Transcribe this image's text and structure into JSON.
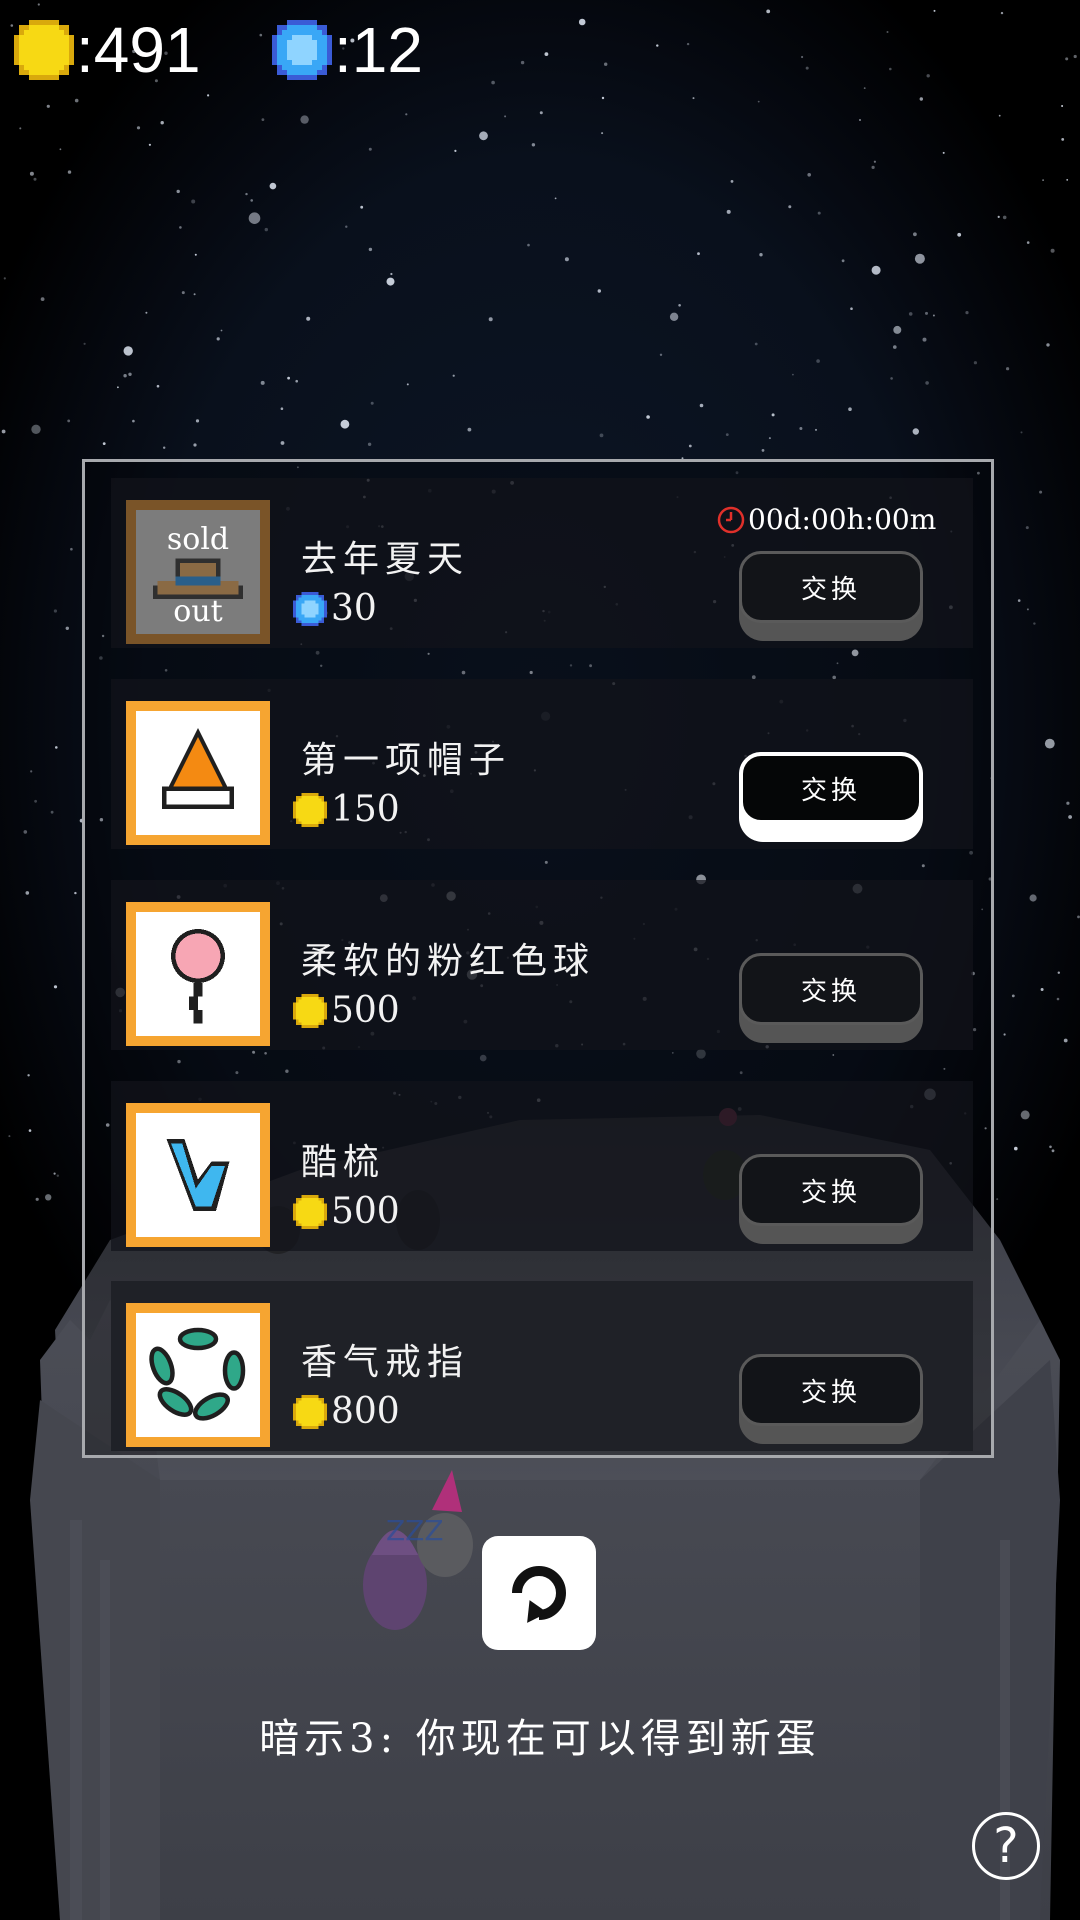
{
  "currency": {
    "coins": ":491",
    "gems": ":12"
  },
  "shop": {
    "items": [
      {
        "name": "去年夏天",
        "price": "30",
        "currency_icon": "gem-icon",
        "sold_out": true,
        "sold_top": "sold",
        "sold_bottom": "out",
        "timer": "00d:00h:00m",
        "button": "交换",
        "icon": "summer-hat-icon"
      },
      {
        "name": "第一项帽子",
        "price": "150",
        "currency_icon": "coin-icon",
        "sold_out": false,
        "button": "交换",
        "icon": "party-hat-icon",
        "selected": true
      },
      {
        "name": "柔软的粉红色球",
        "price": "500",
        "currency_icon": "coin-icon",
        "sold_out": false,
        "button": "交换",
        "icon": "pink-balloon-icon"
      },
      {
        "name": "酷梳",
        "price": "500",
        "currency_icon": "coin-icon",
        "sold_out": false,
        "button": "交换",
        "icon": "blue-comb-icon"
      },
      {
        "name": "香气戒指",
        "price": "800",
        "currency_icon": "coin-icon",
        "sold_out": false,
        "button": "交换",
        "icon": "leaf-ring-icon"
      }
    ]
  },
  "hint": "暗示3: 你现在可以得到新蛋",
  "help": "?",
  "colors": {
    "coin": "#f7d914",
    "gem": "#2f8df0",
    "frame": "#f6a531",
    "panel_border": "#a7a9ad"
  }
}
